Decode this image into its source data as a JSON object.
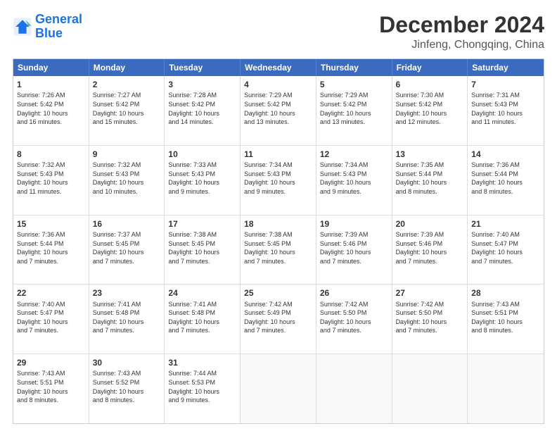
{
  "header": {
    "logo_line1": "General",
    "logo_line2": "Blue",
    "main_title": "December 2024",
    "subtitle": "Jinfeng, Chongqing, China"
  },
  "weekdays": [
    "Sunday",
    "Monday",
    "Tuesday",
    "Wednesday",
    "Thursday",
    "Friday",
    "Saturday"
  ],
  "rows": [
    [
      {
        "day": "1",
        "info": "Sunrise: 7:26 AM\nSunset: 5:42 PM\nDaylight: 10 hours\nand 16 minutes."
      },
      {
        "day": "2",
        "info": "Sunrise: 7:27 AM\nSunset: 5:42 PM\nDaylight: 10 hours\nand 15 minutes."
      },
      {
        "day": "3",
        "info": "Sunrise: 7:28 AM\nSunset: 5:42 PM\nDaylight: 10 hours\nand 14 minutes."
      },
      {
        "day": "4",
        "info": "Sunrise: 7:29 AM\nSunset: 5:42 PM\nDaylight: 10 hours\nand 13 minutes."
      },
      {
        "day": "5",
        "info": "Sunrise: 7:29 AM\nSunset: 5:42 PM\nDaylight: 10 hours\nand 13 minutes."
      },
      {
        "day": "6",
        "info": "Sunrise: 7:30 AM\nSunset: 5:42 PM\nDaylight: 10 hours\nand 12 minutes."
      },
      {
        "day": "7",
        "info": "Sunrise: 7:31 AM\nSunset: 5:43 PM\nDaylight: 10 hours\nand 11 minutes."
      }
    ],
    [
      {
        "day": "8",
        "info": "Sunrise: 7:32 AM\nSunset: 5:43 PM\nDaylight: 10 hours\nand 11 minutes."
      },
      {
        "day": "9",
        "info": "Sunrise: 7:32 AM\nSunset: 5:43 PM\nDaylight: 10 hours\nand 10 minutes."
      },
      {
        "day": "10",
        "info": "Sunrise: 7:33 AM\nSunset: 5:43 PM\nDaylight: 10 hours\nand 9 minutes."
      },
      {
        "day": "11",
        "info": "Sunrise: 7:34 AM\nSunset: 5:43 PM\nDaylight: 10 hours\nand 9 minutes."
      },
      {
        "day": "12",
        "info": "Sunrise: 7:34 AM\nSunset: 5:43 PM\nDaylight: 10 hours\nand 9 minutes."
      },
      {
        "day": "13",
        "info": "Sunrise: 7:35 AM\nSunset: 5:44 PM\nDaylight: 10 hours\nand 8 minutes."
      },
      {
        "day": "14",
        "info": "Sunrise: 7:36 AM\nSunset: 5:44 PM\nDaylight: 10 hours\nand 8 minutes."
      }
    ],
    [
      {
        "day": "15",
        "info": "Sunrise: 7:36 AM\nSunset: 5:44 PM\nDaylight: 10 hours\nand 7 minutes."
      },
      {
        "day": "16",
        "info": "Sunrise: 7:37 AM\nSunset: 5:45 PM\nDaylight: 10 hours\nand 7 minutes."
      },
      {
        "day": "17",
        "info": "Sunrise: 7:38 AM\nSunset: 5:45 PM\nDaylight: 10 hours\nand 7 minutes."
      },
      {
        "day": "18",
        "info": "Sunrise: 7:38 AM\nSunset: 5:45 PM\nDaylight: 10 hours\nand 7 minutes."
      },
      {
        "day": "19",
        "info": "Sunrise: 7:39 AM\nSunset: 5:46 PM\nDaylight: 10 hours\nand 7 minutes."
      },
      {
        "day": "20",
        "info": "Sunrise: 7:39 AM\nSunset: 5:46 PM\nDaylight: 10 hours\nand 7 minutes."
      },
      {
        "day": "21",
        "info": "Sunrise: 7:40 AM\nSunset: 5:47 PM\nDaylight: 10 hours\nand 7 minutes."
      }
    ],
    [
      {
        "day": "22",
        "info": "Sunrise: 7:40 AM\nSunset: 5:47 PM\nDaylight: 10 hours\nand 7 minutes."
      },
      {
        "day": "23",
        "info": "Sunrise: 7:41 AM\nSunset: 5:48 PM\nDaylight: 10 hours\nand 7 minutes."
      },
      {
        "day": "24",
        "info": "Sunrise: 7:41 AM\nSunset: 5:48 PM\nDaylight: 10 hours\nand 7 minutes."
      },
      {
        "day": "25",
        "info": "Sunrise: 7:42 AM\nSunset: 5:49 PM\nDaylight: 10 hours\nand 7 minutes."
      },
      {
        "day": "26",
        "info": "Sunrise: 7:42 AM\nSunset: 5:50 PM\nDaylight: 10 hours\nand 7 minutes."
      },
      {
        "day": "27",
        "info": "Sunrise: 7:42 AM\nSunset: 5:50 PM\nDaylight: 10 hours\nand 7 minutes."
      },
      {
        "day": "28",
        "info": "Sunrise: 7:43 AM\nSunset: 5:51 PM\nDaylight: 10 hours\nand 8 minutes."
      }
    ],
    [
      {
        "day": "29",
        "info": "Sunrise: 7:43 AM\nSunset: 5:51 PM\nDaylight: 10 hours\nand 8 minutes."
      },
      {
        "day": "30",
        "info": "Sunrise: 7:43 AM\nSunset: 5:52 PM\nDaylight: 10 hours\nand 8 minutes."
      },
      {
        "day": "31",
        "info": "Sunrise: 7:44 AM\nSunset: 5:53 PM\nDaylight: 10 hours\nand 9 minutes."
      },
      {
        "day": "",
        "info": ""
      },
      {
        "day": "",
        "info": ""
      },
      {
        "day": "",
        "info": ""
      },
      {
        "day": "",
        "info": ""
      }
    ]
  ]
}
